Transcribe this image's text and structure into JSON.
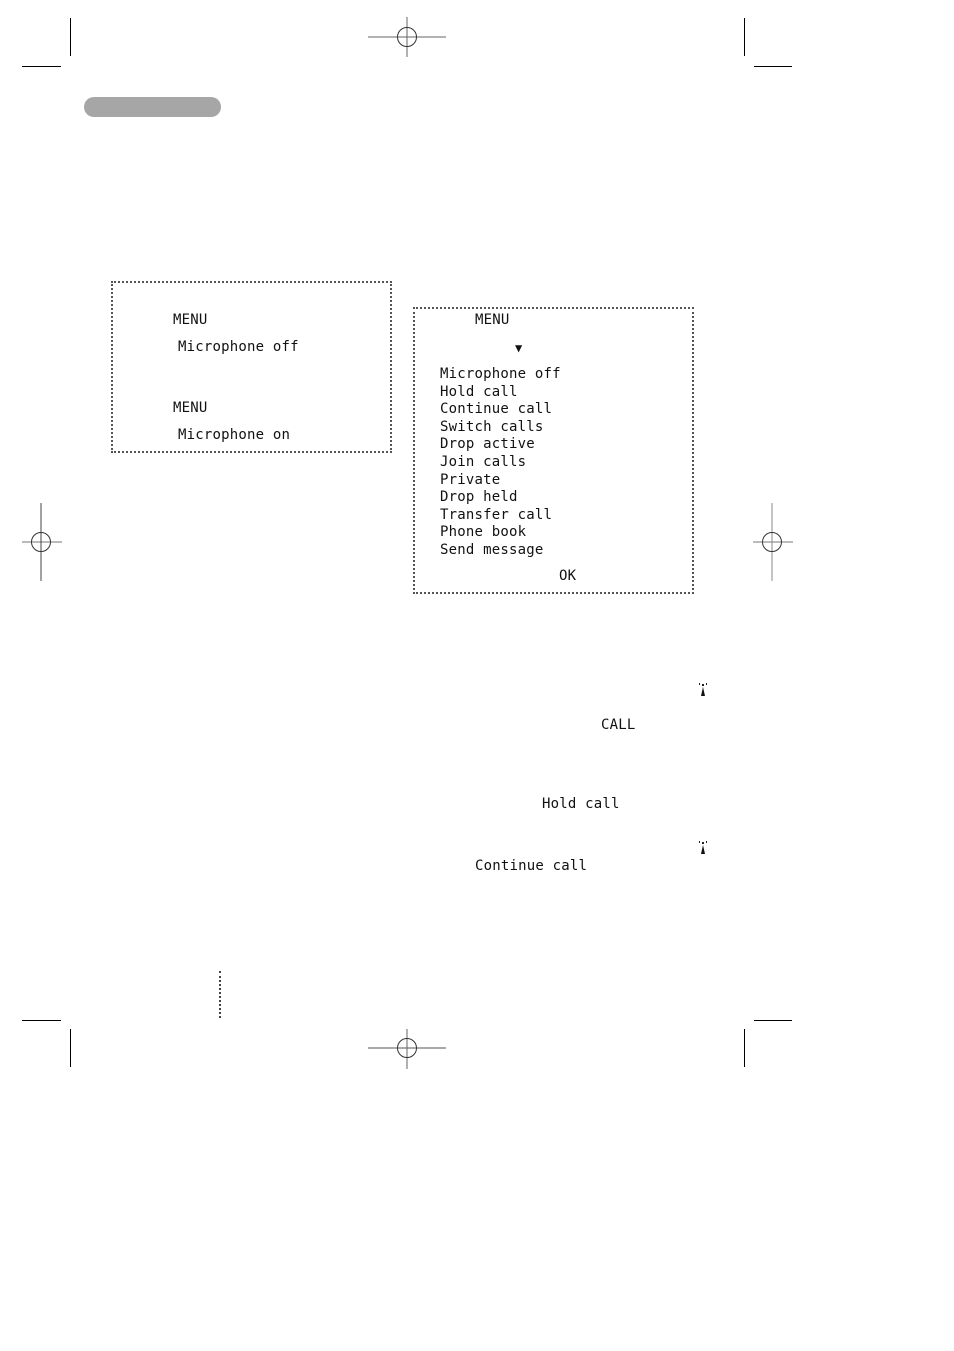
{
  "page": {
    "type": "printed-manual-page",
    "header_bar_color": "#a6a6a6"
  },
  "display_mic": {
    "screens": [
      {
        "title": "MENU",
        "line": "Microphone off"
      },
      {
        "title": "MENU",
        "line": "Microphone on"
      }
    ]
  },
  "display_menu": {
    "title": "MENU",
    "scroll_indicator": "▼",
    "items": [
      "Microphone off",
      "Hold call",
      "Continue call",
      "Switch calls",
      "Drop active",
      "Join calls",
      "Private",
      "Drop held",
      "Transfer call",
      "Phone book",
      "Send message"
    ],
    "softkey": "OK"
  },
  "labels": {
    "call": "CALL",
    "hold_call": "Hold call",
    "continue_call": "Continue call"
  },
  "icons": {
    "antenna_1": "antenna-icon",
    "antenna_2": "antenna-icon"
  }
}
